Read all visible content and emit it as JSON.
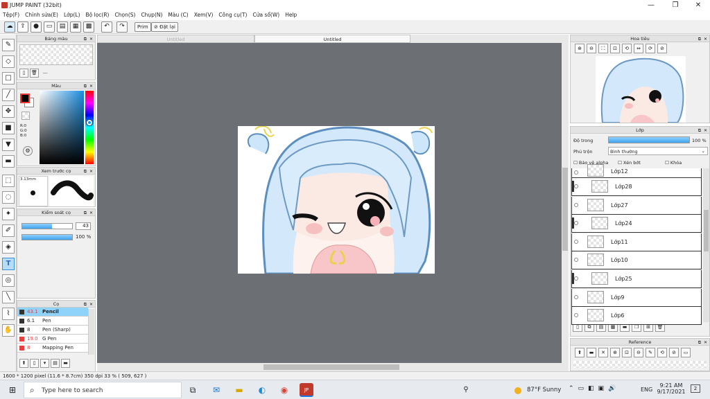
{
  "window": {
    "title": "JUMP PAINT (32bit)",
    "controls": {
      "minimize": "—",
      "maximize": "❐",
      "close": "✕"
    }
  },
  "menu": [
    "Tệp(F)",
    "Chỉnh sửa(E)",
    "Lớp(L)",
    "Bộ lọc(R)",
    "Chọn(S)",
    "Chụp(N)",
    "Màu (C)",
    "Xem(V)",
    "Công cụ(T)",
    "Cửa sổ(W)",
    "Help"
  ],
  "toolbar": {
    "prism_label": "Prim",
    "fit_label": "Đặt lại"
  },
  "panels": {
    "palette": {
      "title": "Bảng màu",
      "dash": "---"
    },
    "color": {
      "title": "Màu",
      "rgb": [
        "R:0",
        "G:0",
        "B:0"
      ],
      "main_color": "#000000",
      "secondary_color": "#ffffff"
    },
    "brush_preview": {
      "title": "Xem trước cọ",
      "size_label": "3.13mm"
    },
    "brush_settings": {
      "title": "Kiểm soát cọ",
      "size_value": "43",
      "opacity_value": "100 %",
      "size_fraction": 0.6,
      "opacity_fraction": 1.0
    },
    "brushes": {
      "title": "Cọ",
      "items": [
        {
          "size": "43.1",
          "name": "Pencil",
          "color": "#333333",
          "selected": true
        },
        {
          "size": "6.1",
          "name": "Pen",
          "color": "#333333",
          "selected": false
        },
        {
          "size": "8",
          "name": "Pen (Sharp)",
          "color": "#333333",
          "selected": false
        },
        {
          "size": "19.0",
          "name": "G Pen",
          "color": "#e84040",
          "selected": false
        },
        {
          "size": "8",
          "name": "Mapping Pen",
          "color": "#e84040",
          "selected": false
        }
      ]
    }
  },
  "tabs": [
    {
      "label": "Untitled",
      "active": false
    },
    {
      "label": "Untitled",
      "active": true
    }
  ],
  "navigator": {
    "title": "Hoa tiêu"
  },
  "layers": {
    "title": "Lớp",
    "opacity_label": "Độ trong",
    "opacity_value": "100 %",
    "opacity_fraction": 1.0,
    "blend_label": "Phủ trộn",
    "blend_value": "Bình thường",
    "checks": [
      "Bảo vệ alpha",
      "Xén bớt",
      "Khóa"
    ],
    "items": [
      {
        "name": "Lớp12",
        "indent": false,
        "clip": false
      },
      {
        "name": "Lớp28",
        "indent": true,
        "clip": true
      },
      {
        "name": "Lớp27",
        "indent": false,
        "clip": false
      },
      {
        "name": "Lớp24",
        "indent": true,
        "clip": true
      },
      {
        "name": "Lớp11",
        "indent": false,
        "clip": false
      },
      {
        "name": "Lớp10",
        "indent": false,
        "clip": false
      },
      {
        "name": "Lớp25",
        "indent": true,
        "clip": true
      },
      {
        "name": "Lớp9",
        "indent": false,
        "clip": false
      },
      {
        "name": "Lớp6",
        "indent": false,
        "clip": false
      }
    ]
  },
  "reference": {
    "title": "Reference"
  },
  "status": {
    "size": "1600 * 1200 pixel  (11.6 * 8.7cm)  350 dpi  33 %  ( 509, 627 )"
  },
  "taskbar": {
    "search_placeholder": "Type here to search",
    "weather": "87°F  Sunny",
    "lang": "ENG",
    "time": "9:21 AM",
    "date": "9/17/2021",
    "notif_count": "2"
  }
}
